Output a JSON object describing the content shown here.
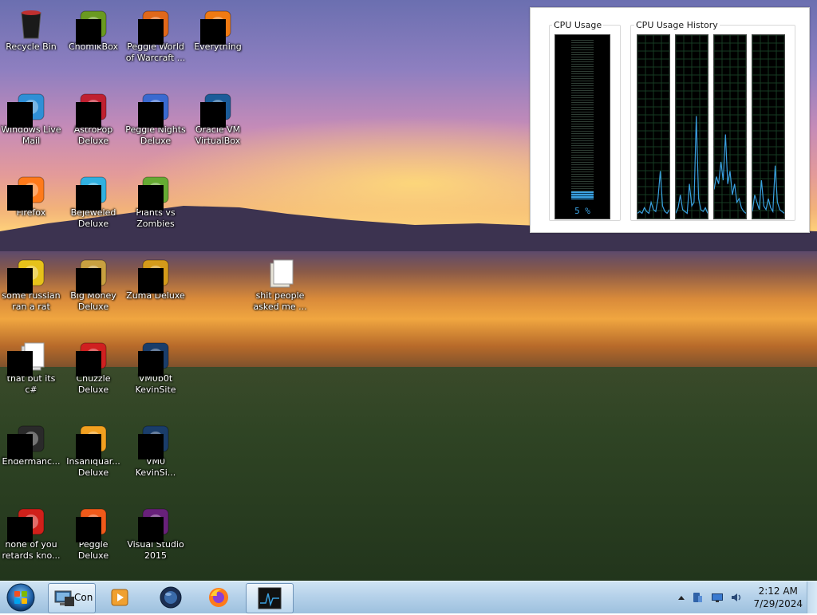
{
  "desktop": {
    "icons": [
      {
        "label": "Recycle Bin",
        "icon": "recycle-bin-icon"
      },
      {
        "label": "ChomikBox",
        "icon": "chomikbox-icon"
      },
      {
        "label": "Peggle World\nof Warcraft ...",
        "icon": "peggle-wow-icon"
      },
      {
        "label": "Everything",
        "icon": "everything-search-icon"
      },
      {
        "label": "Windows Live\nMail",
        "icon": "windows-live-mail-icon"
      },
      {
        "label": "AstroPop\nDeluxe",
        "icon": "astropop-icon"
      },
      {
        "label": "Peggle Nights\nDeluxe",
        "icon": "peggle-nights-icon"
      },
      {
        "label": "Oracle VM\nVirtualBox",
        "icon": "virtualbox-icon"
      },
      {
        "label": "Firefox",
        "icon": "firefox-icon"
      },
      {
        "label": "Bejeweled\nDeluxe",
        "icon": "bejeweled-icon"
      },
      {
        "label": "Plants vs\nZombies",
        "icon": "plants-vs-zombies-icon"
      },
      {
        "label": "some russian\nran a rat",
        "icon": "document-icon"
      },
      {
        "label": "Big Money\nDeluxe",
        "icon": "big-money-icon"
      },
      {
        "label": "Zuma Deluxe",
        "icon": "zuma-icon"
      },
      {
        "label": "shit people\nasked me ...",
        "icon": "folder-icon"
      },
      {
        "label": "that but its c#",
        "icon": "files-icon"
      },
      {
        "label": "Chuzzle\nDeluxe",
        "icon": "chuzzle-icon"
      },
      {
        "label": "VM0b0t\nKevinSite",
        "icon": "vm-shortcut-icon"
      },
      {
        "label": "Endermanc...",
        "icon": "terminal-icon"
      },
      {
        "label": "Insaniquar...\nDeluxe",
        "icon": "insaniquarium-icon"
      },
      {
        "label": "VM0\nKevinSi...",
        "icon": "vm-shortcut-icon"
      },
      {
        "label": "none of you\nretards kno...",
        "icon": "opera-icon"
      },
      {
        "label": "Peggle Deluxe",
        "icon": "peggle-icon"
      },
      {
        "label": "Visual Studio\n2015",
        "icon": "visual-studio-icon"
      }
    ]
  },
  "cpu_widget": {
    "usage_title": "CPU Usage",
    "history_title": "CPU Usage History",
    "usage_value": "5 %",
    "usage_fraction": 0.05,
    "accent": "#3aa0e0",
    "history": [
      [
        2,
        3,
        2,
        5,
        3,
        2,
        8,
        4,
        3,
        10,
        25,
        6,
        3,
        2,
        4
      ],
      [
        2,
        5,
        12,
        4,
        3,
        2,
        18,
        6,
        8,
        55,
        10,
        4,
        3,
        5,
        2
      ],
      [
        15,
        22,
        18,
        30,
        20,
        45,
        18,
        25,
        12,
        18,
        8,
        10,
        5,
        3,
        2
      ],
      [
        3,
        12,
        8,
        4,
        20,
        6,
        4,
        10,
        5,
        3,
        28,
        8,
        4,
        3,
        2
      ]
    ]
  },
  "taskbar": {
    "start": "start-orb-icon",
    "active_label": "Con",
    "clock": {
      "time": "2:12 AM",
      "date": "7/29/2024"
    }
  }
}
